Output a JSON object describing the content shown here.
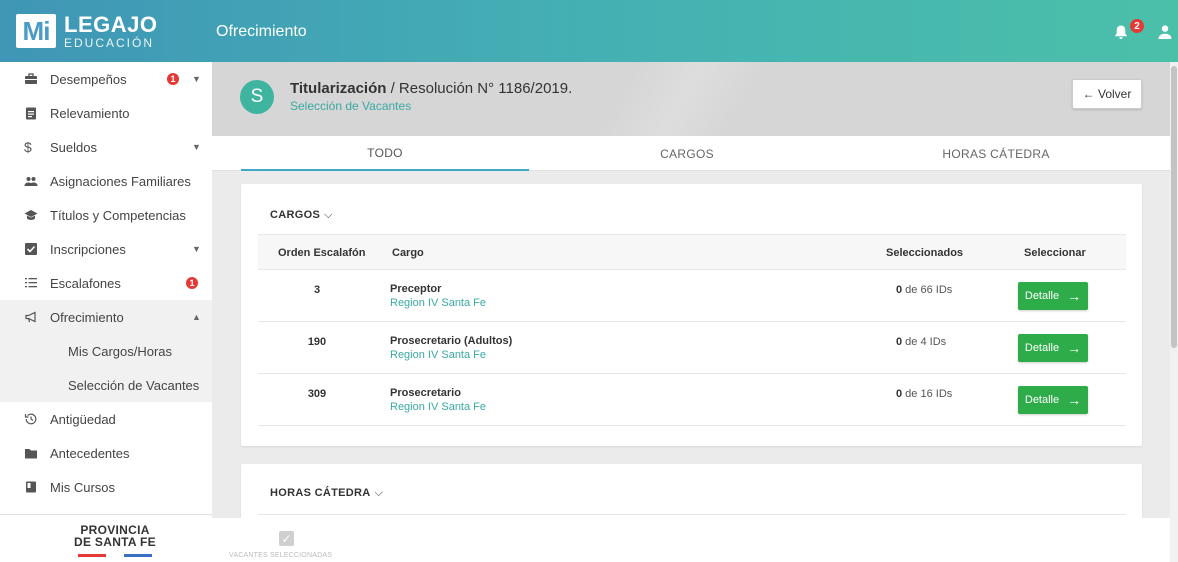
{
  "brand": {
    "mark": "Mi",
    "title": "LEGAJO",
    "subtitle": "EDUCACIÓN"
  },
  "topbar": {
    "title": "Ofrecimiento",
    "notifications": "2"
  },
  "sidebar": {
    "items": [
      {
        "label": "Desempeños",
        "badge": "1"
      },
      {
        "label": "Relevamiento"
      },
      {
        "label": "Sueldos"
      },
      {
        "label": "Asignaciones Familiares"
      },
      {
        "label": "Títulos y Competencias"
      },
      {
        "label": "Inscripciones"
      },
      {
        "label": "Escalafones",
        "badge": "1"
      },
      {
        "label": "Ofrecimiento"
      },
      {
        "label": "Antigüedad"
      },
      {
        "label": "Antecedentes"
      },
      {
        "label": "Mis Cursos"
      }
    ],
    "subitems": [
      {
        "label": "Mis Cargos/Horas"
      },
      {
        "label": "Selección de Vacantes"
      }
    ],
    "footer": {
      "line1": "PROVINCIA",
      "line2": "DE SANTA FE",
      "color1": "#e53935",
      "color2": "#3a6fc4"
    }
  },
  "header": {
    "avatar": "S",
    "title_bold": "Titularización",
    "title_rest": " / Resolución N° 1186/2019.",
    "subtitle": "Selección de Vacantes",
    "back_label": "← Volver"
  },
  "tabs": [
    {
      "label": "TODO"
    },
    {
      "label": "CARGOS"
    },
    {
      "label": "HORAS CÁTEDRA"
    }
  ],
  "cargos": {
    "title": "CARGOS",
    "columns": {
      "orden": "Orden Escalafón",
      "cargo": "Cargo",
      "seleccionados": "Seleccionados",
      "seleccionar": "Seleccionar"
    },
    "rows": [
      {
        "orden": "3",
        "cargo": "Preceptor",
        "region": "Region IV Santa Fe",
        "sel_count": "0",
        "sel_rest": " de 66 IDs",
        "action": "Detalle"
      },
      {
        "orden": "190",
        "cargo": "Prosecretario (Adultos)",
        "region": "Region IV Santa Fe",
        "sel_count": "0",
        "sel_rest": " de 4 IDs",
        "action": "Detalle"
      },
      {
        "orden": "309",
        "cargo": "Prosecretario",
        "region": "Region IV Santa Fe",
        "sel_count": "0",
        "sel_rest": " de 16 IDs",
        "action": "Detalle"
      }
    ]
  },
  "horas": {
    "title": "HORAS CÁTEDRA"
  },
  "bottom": {
    "label": "VACANTES SELECCIONADAS"
  },
  "colors": {
    "accent": "#3aa9a2",
    "button": "#2eac4a",
    "badge": "#e53935"
  }
}
